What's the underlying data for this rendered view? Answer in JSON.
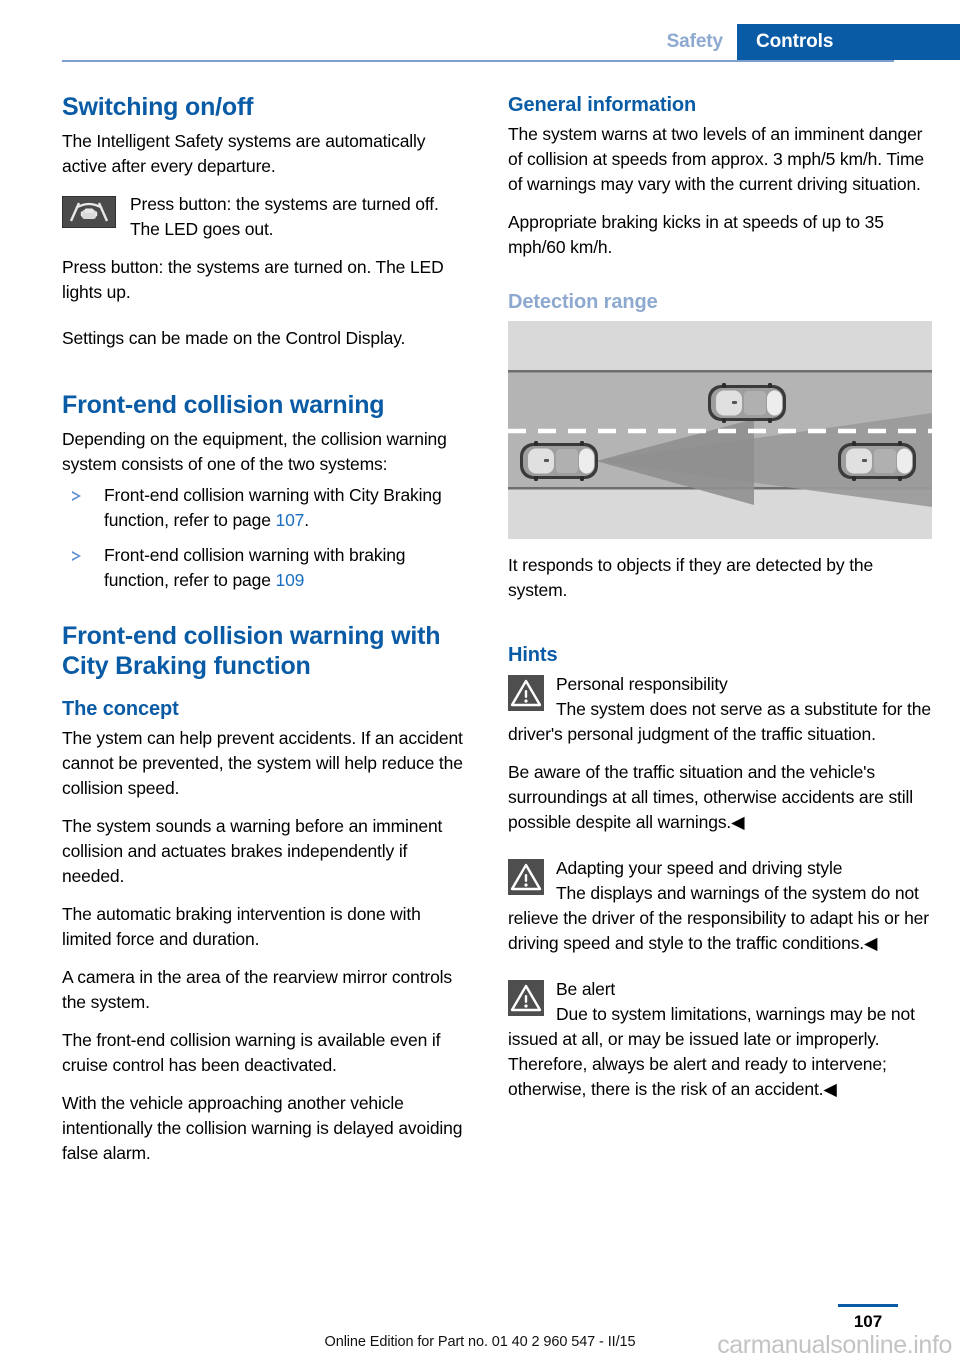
{
  "header": {
    "tab_inactive": "Safety",
    "tab_active": "Controls",
    "accent_blue": "#0a5ba5",
    "muted_blue": "#8ea9cf"
  },
  "left_column": {
    "heading_switching": "Switching on/off",
    "p_auto_active": "The Intelligent Safety systems are automatically active after every departure.",
    "button_icon_name": "intelligent-safety-button",
    "p_button_off": "Press button: the systems are turned off. The LED goes out.",
    "p_button_on": "Press button: the systems are turned on. The LED lights up.",
    "p_settings": "Settings can be made on the Control Display.",
    "heading_fcw": "Front-end collision warning",
    "p_depending": "Depending on the equipment, the collision warning system consists of one of the two systems:",
    "bullets": [
      {
        "text_before": "Front-end collision warning with City Braking function, refer to page ",
        "page_link": "107",
        "text_after": "."
      },
      {
        "text_before": "Front-end collision warning with braking function, refer to page ",
        "page_link": "109",
        "text_after": ""
      }
    ],
    "heading_fcw_city": "Front-end collision warning with City Braking function",
    "heading_concept": "The concept",
    "p_concept_1": "The ystem can help prevent accidents. If an accident cannot be prevented, the system will help reduce the collision speed.",
    "p_concept_2": "The system sounds a warning before an imminent collision and actuates brakes independently if needed.",
    "p_concept_3": "The automatic braking intervention is done with limited force and duration.",
    "p_concept_4": "A camera in the area of the rearview mirror controls the system.",
    "p_concept_5": "The front-end collision warning is available even if cruise control has been deactivated.",
    "p_concept_6": "With the vehicle approaching another vehicle intentionally the collision warning is delayed avoiding false alarm."
  },
  "right_column": {
    "heading_general": "General information",
    "p_general_1": "The system warns at two levels of an imminent danger of collision at speeds from approx. 3 mph/5 km/h. Time of warnings may vary with the current driving situation.",
    "p_general_2": "Appropriate braking kicks in at speeds of up to 35 mph/60 km/h.",
    "heading_detection": "Detection range",
    "illustration_name": "detection-range-diagram",
    "p_responds": "It responds to objects if they are detected by the system.",
    "heading_hints": "Hints",
    "hints": [
      {
        "icon": "warning-triangle-icon",
        "title": "Personal responsibility",
        "paragraphs": [
          "The system does not serve as a substitute for the driver's personal judgment of the traffic situation.",
          "Be aware of the traffic situation and the vehicle's surroundings at all times, otherwise accidents are still possible despite all warnings.◀"
        ]
      },
      {
        "icon": "warning-triangle-icon",
        "title": "Adapting your speed and driving style",
        "paragraphs": [
          "The displays and warnings of the system do not relieve the driver of the responsibility to adapt his or her driving speed and style to the traffic conditions.◀"
        ]
      },
      {
        "icon": "warning-triangle-icon",
        "title": "Be alert",
        "paragraphs": [
          "Due to system limitations, warnings may be not issued at all, or may be issued late or improperly. Therefore, always be alert and ready to intervene; otherwise, there is the risk of an accident.◀"
        ]
      }
    ]
  },
  "footer": {
    "page_number": "107",
    "edition_text": "Online Edition for Part no. 01 40 2 960 547 - II/15",
    "watermark": "carmanualsonline.info"
  }
}
